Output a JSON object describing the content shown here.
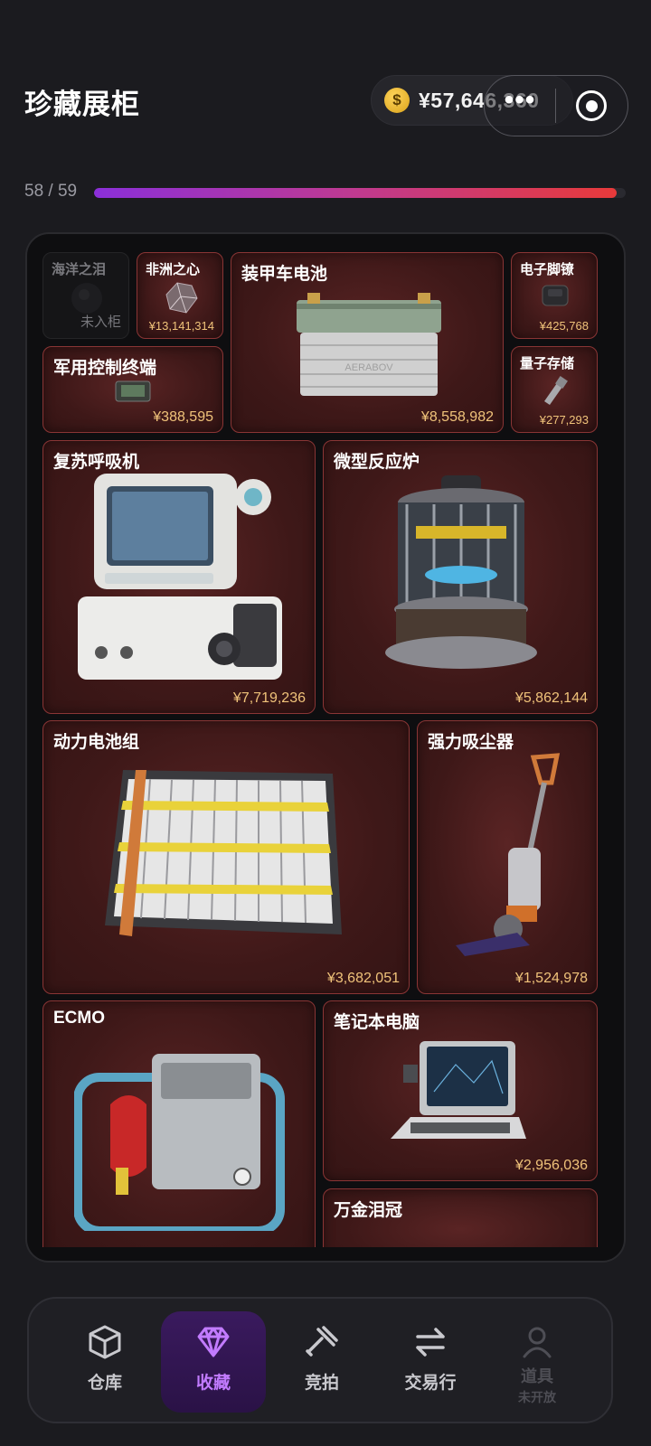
{
  "header": {
    "title": "珍藏展柜",
    "balance": "¥57,646,360",
    "more_label": "•••"
  },
  "progress": {
    "text": "58 / 59",
    "fraction": 0.983
  },
  "items": [
    {
      "name": "海洋之泪",
      "status": "未入柜"
    },
    {
      "name": "非洲之心",
      "price": "¥13,141,314"
    },
    {
      "name": "装甲车电池",
      "price": "¥8,558,982"
    },
    {
      "name": "电子脚镣",
      "price": "¥425,768"
    },
    {
      "name": "军用控制终端",
      "price": "¥388,595"
    },
    {
      "name": "量子存储",
      "price": "¥277,293"
    },
    {
      "name": "复苏呼吸机",
      "price": "¥7,719,236"
    },
    {
      "name": "微型反应炉",
      "price": "¥5,862,144"
    },
    {
      "name": "动力电池组",
      "price": "¥3,682,051"
    },
    {
      "name": "强力吸尘器",
      "price": "¥1,524,978"
    },
    {
      "name": "ECMO",
      "price": ""
    },
    {
      "name": "笔记本电脑",
      "price": "¥2,956,036"
    },
    {
      "name": "万金泪冠",
      "price": ""
    }
  ],
  "nav": [
    {
      "label": "仓库",
      "icon": "box-icon"
    },
    {
      "label": "收藏",
      "icon": "diamond-icon",
      "active": true
    },
    {
      "label": "竞拍",
      "icon": "gavel-icon"
    },
    {
      "label": "交易行",
      "icon": "exchange-icon"
    },
    {
      "label": "道具",
      "sub": "未开放",
      "icon": "person-icon",
      "disabled": true
    }
  ],
  "colors": {
    "background": "#1b1b1f",
    "card": "#3e1818",
    "card_border": "#8a3535",
    "price": "#f0c37a",
    "accent": "#c27bff"
  }
}
